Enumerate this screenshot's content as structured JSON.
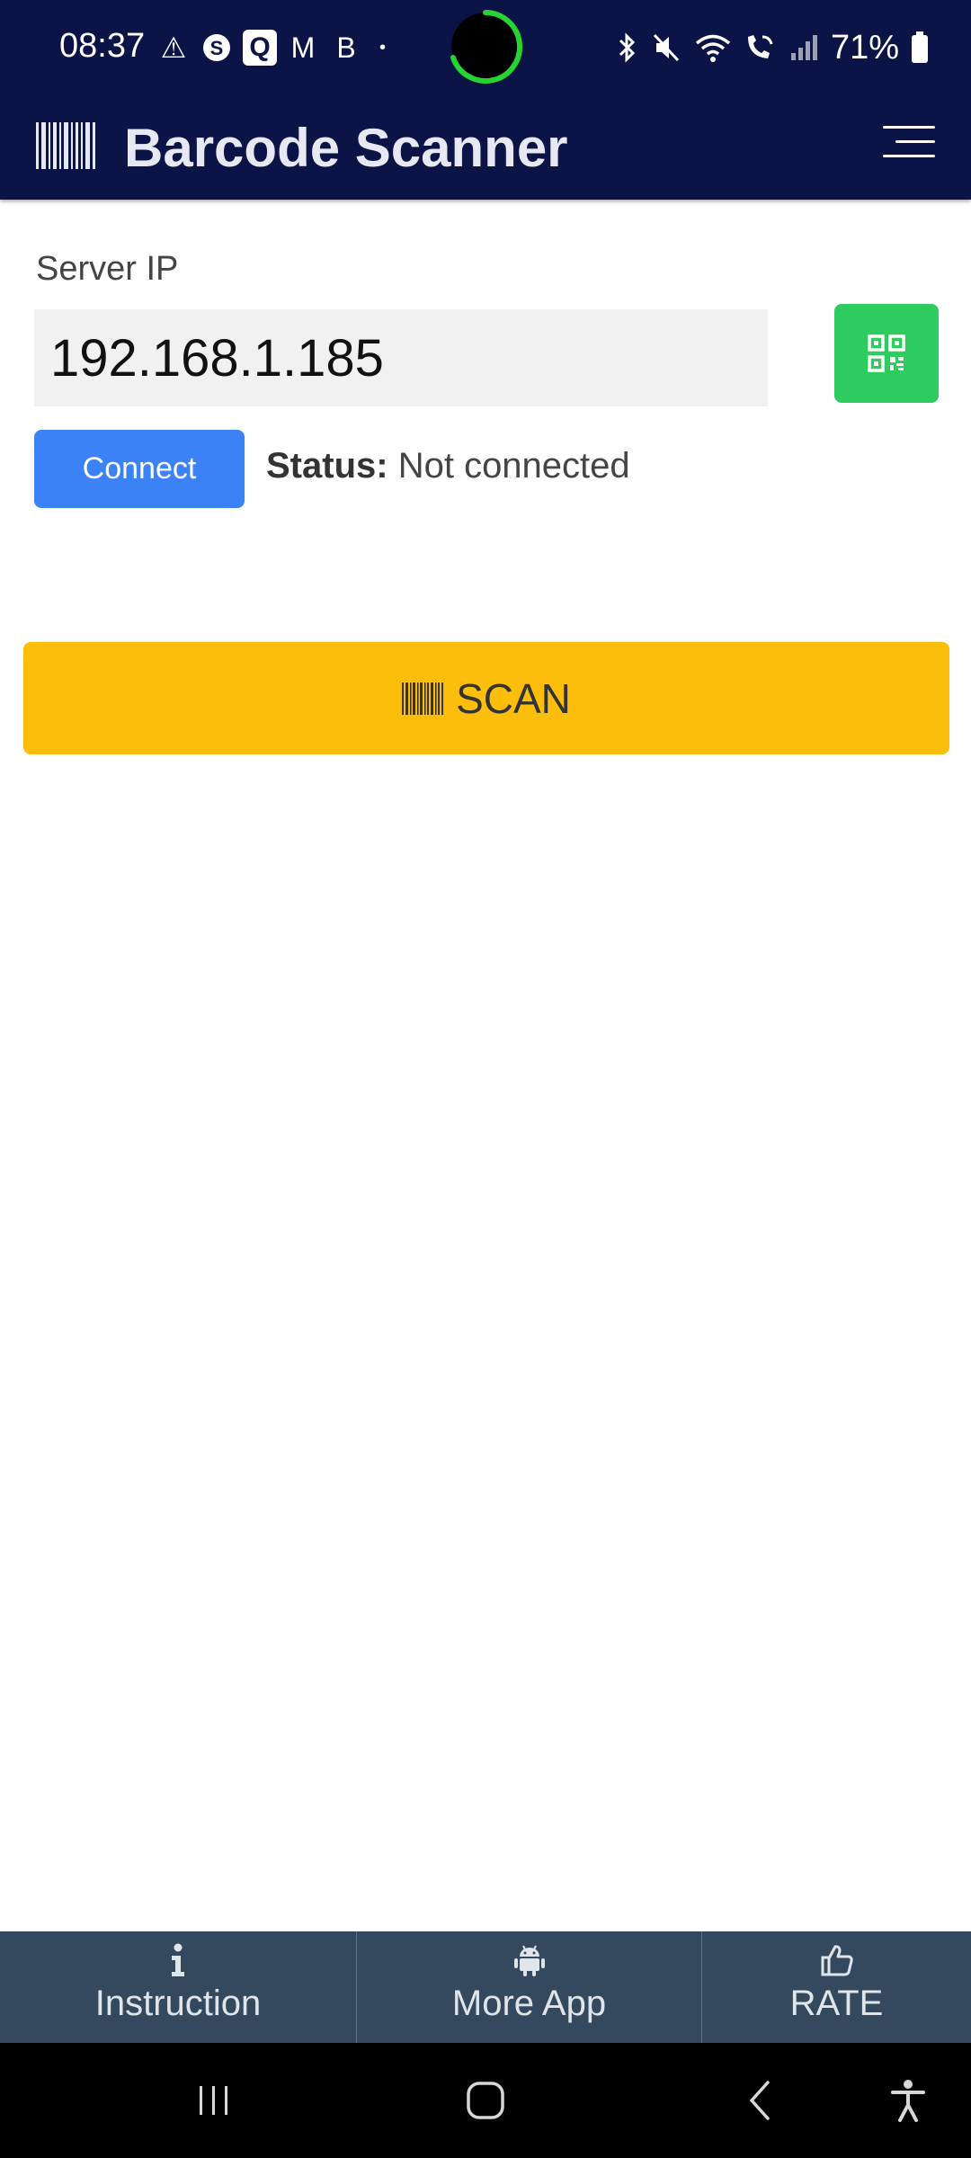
{
  "status_bar": {
    "time": "08:37",
    "battery": "71%",
    "icons_left": [
      "warning-icon",
      "skype-icon",
      "q-app-icon",
      "gmail-icon",
      "bixby-icon",
      "dot-icon"
    ],
    "icons_right": [
      "bluetooth-icon",
      "mute-icon",
      "wifi-icon",
      "wifi-call-icon",
      "signal-icon",
      "battery-icon"
    ],
    "left_glyphs": {
      "warning": "⚠",
      "skype": "S",
      "q": "Q",
      "gmail": "M",
      "bixby": "B",
      "dot": "•"
    }
  },
  "app_bar": {
    "title": "Barcode Scanner"
  },
  "form": {
    "server_label": "Server IP",
    "server_ip": "192.168.1.185",
    "connect_label": "Connect",
    "status_key": "Status:",
    "status_value": "Not connected"
  },
  "scan": {
    "label": "SCAN"
  },
  "bottom_tabs": [
    {
      "label": "Instruction",
      "icon": "info-icon"
    },
    {
      "label": "More App",
      "icon": "android-icon"
    },
    {
      "label": "RATE",
      "icon": "thumbs-up-icon"
    }
  ],
  "colors": {
    "header_bg": "#0c1447",
    "qr_button": "#2ecc5e",
    "connect_button": "#3b82f6",
    "scan_button": "#fdbd0b",
    "bottom_bar": "#34495e"
  }
}
